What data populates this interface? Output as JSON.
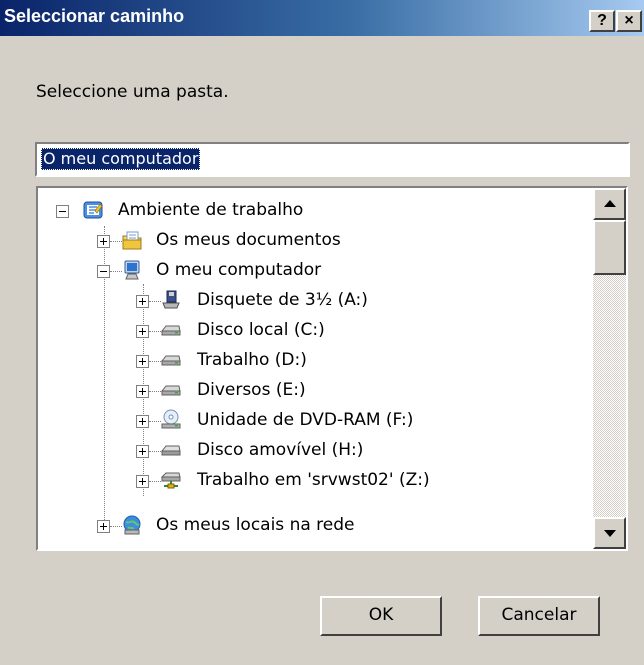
{
  "window": {
    "title": "Seleccionar caminho",
    "help_label": "?",
    "close_label": "×"
  },
  "prompt": "Seleccione uma pasta.",
  "path_field": {
    "value": "O meu computador"
  },
  "tree": {
    "root": {
      "label": "Ambiente de trabalho",
      "icon": "desktop-icon",
      "expanded": true
    },
    "items": [
      {
        "label": "Os meus documentos",
        "icon": "my-documents-icon",
        "level": 1,
        "expander": "plus"
      },
      {
        "label": "O meu computador",
        "icon": "my-computer-icon",
        "level": 1,
        "expander": "minus"
      },
      {
        "label": "Disquete de 3½ (A:)",
        "icon": "floppy-drive-icon",
        "level": 2,
        "expander": "plus"
      },
      {
        "label": "Disco local (C:)",
        "icon": "hard-drive-icon",
        "level": 2,
        "expander": "plus"
      },
      {
        "label": "Trabalho (D:)",
        "icon": "hard-drive-icon",
        "level": 2,
        "expander": "plus"
      },
      {
        "label": "Diversos (E:)",
        "icon": "hard-drive-icon",
        "level": 2,
        "expander": "plus"
      },
      {
        "label": "Unidade de DVD-RAM (F:)",
        "icon": "dvd-drive-icon",
        "level": 2,
        "expander": "plus"
      },
      {
        "label": "Disco amovível (H:)",
        "icon": "removable-disk-icon",
        "level": 2,
        "expander": "plus"
      },
      {
        "label": "Trabalho em 'srvwst02' (Z:)",
        "icon": "network-drive-icon",
        "level": 2,
        "expander": "plus"
      },
      {
        "label": "Os meus locais na rede",
        "icon": "network-places-icon",
        "level": 1,
        "expander": "plus"
      }
    ]
  },
  "buttons": {
    "ok": "OK",
    "cancel": "Cancelar"
  },
  "colors": {
    "titlebar_start": "#0a246a",
    "titlebar_end": "#a6caf0",
    "selection": "#0a246a",
    "face": "#d4d0c8"
  }
}
